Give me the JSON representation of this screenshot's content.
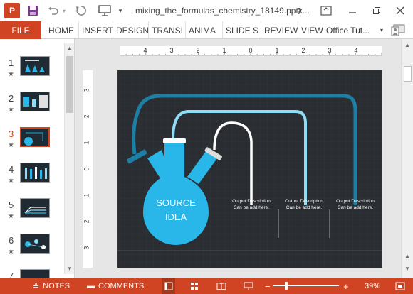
{
  "titlebar": {
    "app_icon_letter": "P",
    "document_title": "mixing_the_formulas_chemistry_18149.pptx...",
    "help_label": "?"
  },
  "ribbon": {
    "file_label": "FILE",
    "tabs": [
      "HOME",
      "INSERT",
      "DESIGN",
      "TRANSI",
      "ANIMA",
      "SLIDE S",
      "REVIEW",
      "VIEW"
    ],
    "account_name": "Office Tut..."
  },
  "thumbnails": {
    "items": [
      {
        "number": "1",
        "star": "★"
      },
      {
        "number": "2",
        "star": "★"
      },
      {
        "number": "3",
        "star": "★"
      },
      {
        "number": "4",
        "star": "★"
      },
      {
        "number": "5",
        "star": "★"
      },
      {
        "number": "6",
        "star": "★"
      },
      {
        "number": "7",
        "star": ""
      }
    ],
    "active_index": 2
  },
  "rulers": {
    "horizontal": [
      "4",
      "3",
      "2",
      "1",
      "0",
      "1",
      "2",
      "3",
      "4"
    ],
    "vertical": [
      "3",
      "2",
      "1",
      "0",
      "1",
      "2",
      "3"
    ]
  },
  "slide": {
    "flask_label_line1": "SOURCE",
    "flask_label_line2": "IDEA",
    "outputs": [
      {
        "line1": "Output Description",
        "line2": "Can be add here."
      },
      {
        "line1": "Output Description",
        "line2": "Can be add here."
      },
      {
        "line1": "Output Description",
        "line2": "Can be add here."
      }
    ],
    "colors": {
      "background": "#2a2e33",
      "flask": "#29b6e8",
      "tube_dark": "#1b7fa6",
      "tube_light": "#8fdcf5",
      "tube_white": "#ffffff"
    }
  },
  "statusbar": {
    "notes_label": "NOTES",
    "comments_label": "COMMENTS",
    "zoom_minus": "−",
    "zoom_plus": "+",
    "zoom_level": "39%"
  },
  "colors": {
    "accent": "#d04423"
  }
}
